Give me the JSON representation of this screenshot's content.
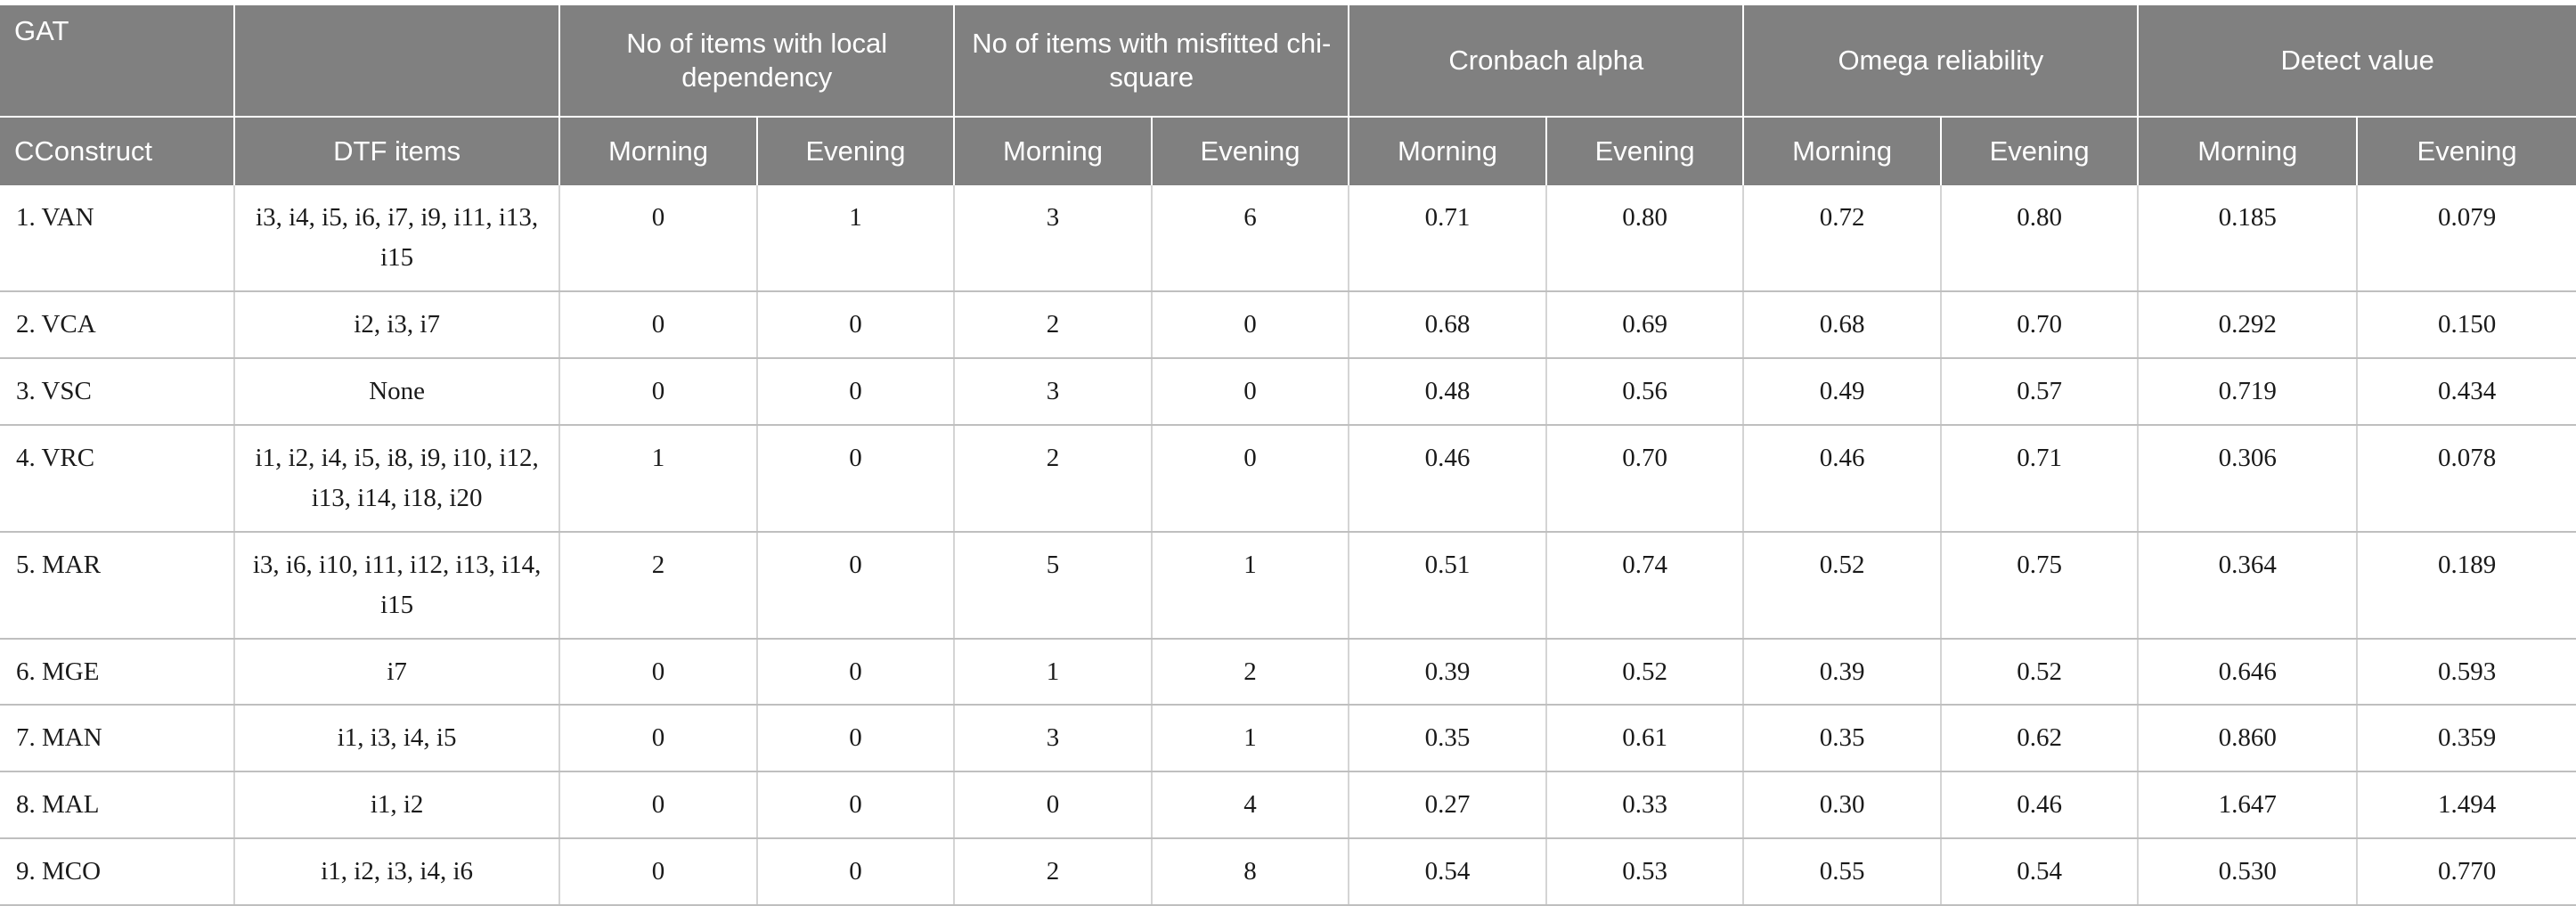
{
  "table": {
    "corner_label": "GAT",
    "groups": [
      {
        "label": "GAT",
        "span": 1
      },
      {
        "label": "",
        "span": 1
      },
      {
        "label": "No of items with local dependency",
        "span": 2
      },
      {
        "label": "No of items with misfitted chi-square",
        "span": 2
      },
      {
        "label": "Cronbach alpha",
        "span": 2
      },
      {
        "label": "Omega reliability",
        "span": 2
      },
      {
        "label": "Detect value",
        "span": 2
      }
    ],
    "subheaders": [
      "CConstruct",
      "DTF items",
      "Morning",
      "Evening",
      "Morning",
      "Evening",
      "Morning",
      "Evening",
      "Morning",
      "Evening",
      "Morning",
      "Evening"
    ],
    "rows": [
      {
        "construct": "1. VAN",
        "dtf_items": "i3, i4, i5, i6, i7, i9, i11, i13, i15",
        "ld_morning": "0",
        "ld_evening": "1",
        "chi_morning": "3",
        "chi_evening": "6",
        "alpha_morning": "0.71",
        "alpha_evening": "0.80",
        "omega_morning": "0.72",
        "omega_evening": "0.80",
        "detect_morning": "0.185",
        "detect_evening": "0.079"
      },
      {
        "construct": "2. VCA",
        "dtf_items": "i2, i3, i7",
        "ld_morning": "0",
        "ld_evening": "0",
        "chi_morning": "2",
        "chi_evening": "0",
        "alpha_morning": "0.68",
        "alpha_evening": "0.69",
        "omega_morning": "0.68",
        "omega_evening": "0.70",
        "detect_morning": "0.292",
        "detect_evening": "0.150"
      },
      {
        "construct": "3. VSC",
        "dtf_items": "None",
        "ld_morning": "0",
        "ld_evening": "0",
        "chi_morning": "3",
        "chi_evening": "0",
        "alpha_morning": "0.48",
        "alpha_evening": "0.56",
        "omega_morning": "0.49",
        "omega_evening": "0.57",
        "detect_morning": "0.719",
        "detect_evening": "0.434"
      },
      {
        "construct": "4. VRC",
        "dtf_items": "i1, i2, i4, i5, i8, i9, i10, i12, i13, i14, i18, i20",
        "ld_morning": "1",
        "ld_evening": "0",
        "chi_morning": "2",
        "chi_evening": "0",
        "alpha_morning": "0.46",
        "alpha_evening": "0.70",
        "omega_morning": "0.46",
        "omega_evening": "0.71",
        "detect_morning": "0.306",
        "detect_evening": "0.078"
      },
      {
        "construct": "5. MAR",
        "dtf_items": "i3, i6, i10, i11, i12, i13, i14, i15",
        "ld_morning": "2",
        "ld_evening": "0",
        "chi_morning": "5",
        "chi_evening": "1",
        "alpha_morning": "0.51",
        "alpha_evening": "0.74",
        "omega_morning": "0.52",
        "omega_evening": "0.75",
        "detect_morning": "0.364",
        "detect_evening": "0.189"
      },
      {
        "construct": "6. MGE",
        "dtf_items": "i7",
        "ld_morning": "0",
        "ld_evening": "0",
        "chi_morning": "1",
        "chi_evening": "2",
        "alpha_morning": "0.39",
        "alpha_evening": "0.52",
        "omega_morning": "0.39",
        "omega_evening": "0.52",
        "detect_morning": "0.646",
        "detect_evening": "0.593"
      },
      {
        "construct": "7. MAN",
        "dtf_items": "i1, i3, i4, i5",
        "ld_morning": "0",
        "ld_evening": "0",
        "chi_morning": "3",
        "chi_evening": "1",
        "alpha_morning": "0.35",
        "alpha_evening": "0.61",
        "omega_morning": "0.35",
        "omega_evening": "0.62",
        "detect_morning": "0.860",
        "detect_evening": "0.359"
      },
      {
        "construct": "8. MAL",
        "dtf_items": "i1, i2",
        "ld_morning": "0",
        "ld_evening": "0",
        "chi_morning": "0",
        "chi_evening": "4",
        "alpha_morning": "0.27",
        "alpha_evening": "0.33",
        "omega_morning": "0.30",
        "omega_evening": "0.46",
        "detect_morning": "1.647",
        "detect_evening": "1.494"
      },
      {
        "construct": "9. MCO",
        "dtf_items": "i1, i2, i3, i4, i6",
        "ld_morning": "0",
        "ld_evening": "0",
        "chi_morning": "2",
        "chi_evening": "8",
        "alpha_morning": "0.54",
        "alpha_evening": "0.53",
        "omega_morning": "0.55",
        "omega_evening": "0.54",
        "detect_morning": "0.530",
        "detect_evening": "0.770"
      }
    ]
  },
  "colors": {
    "header_bg": "#808080",
    "header_text": "#ffffff",
    "body_text": "#1a1a1a",
    "grid_line": "#bfbfbf",
    "page_bg": "#ffffff"
  }
}
